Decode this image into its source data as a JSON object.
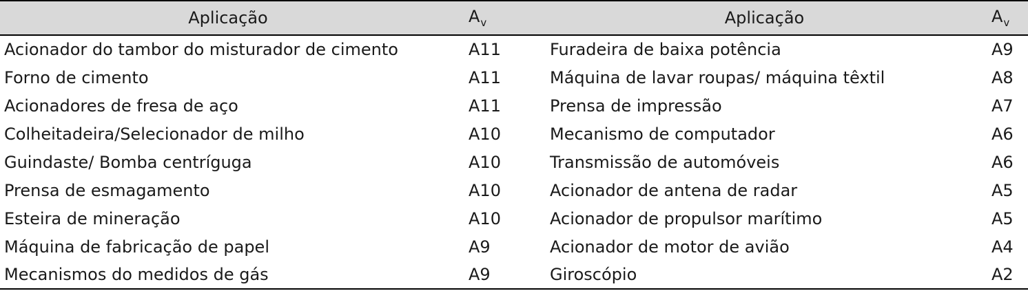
{
  "header": {
    "col1": "Aplicação",
    "col2_main": "A",
    "col2_sub": "v",
    "col3": "Aplicação",
    "col4_main": "A",
    "col4_sub": "v"
  },
  "rows": [
    {
      "left_app": "Acionador do tambor do misturador de cimento",
      "left_av": "A11",
      "right_app": "Furadeira de baixa potência",
      "right_av": "A9"
    },
    {
      "left_app": "Forno de cimento",
      "left_av": "A11",
      "right_app": "Máquina de lavar roupas/ máquina têxtil",
      "right_av": "A8"
    },
    {
      "left_app": "Acionadores de fresa de aço",
      "left_av": "A11",
      "right_app": "Prensa de impressão",
      "right_av": "A7"
    },
    {
      "left_app": "Colheitadeira/Selecionador de milho",
      "left_av": "A10",
      "right_app": "Mecanismo de computador",
      "right_av": "A6"
    },
    {
      "left_app": "Guindaste/ Bomba centríguga",
      "left_av": "A10",
      "right_app": "Transmissão de automóveis",
      "right_av": "A6"
    },
    {
      "left_app": "Prensa de esmagamento",
      "left_av": "A10",
      "right_app": "Acionador de antena de radar",
      "right_av": "A5"
    },
    {
      "left_app": "Esteira de mineração",
      "left_av": "A10",
      "right_app": "Acionador de propulsor marítimo",
      "right_av": "A5"
    },
    {
      "left_app": "Máquina de fabricação de papel",
      "left_av": "A9",
      "right_app": "Acionador de motor de avião",
      "right_av": "A4"
    },
    {
      "left_app": "Mecanismos do medidos de gás",
      "left_av": "A9",
      "right_app": "Giroscópio",
      "right_av": "A2"
    }
  ],
  "colors": {
    "header_bg": "#d9d9d9",
    "rule": "#000000",
    "text": "#1a1a1a"
  }
}
